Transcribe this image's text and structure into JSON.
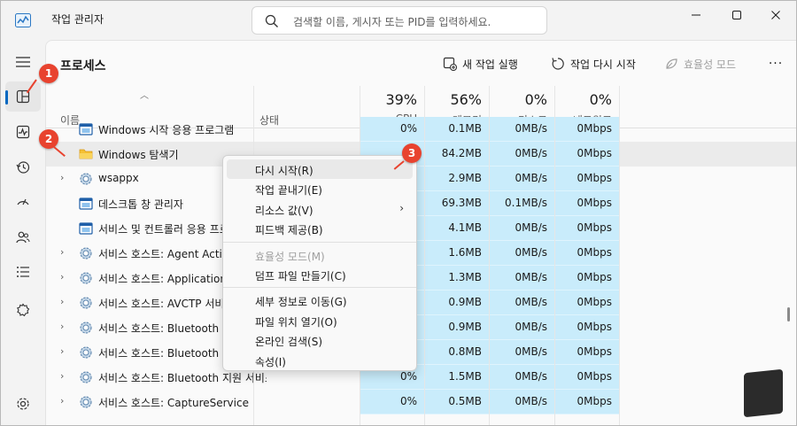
{
  "window": {
    "title": "작업 관리자",
    "search_placeholder": "검색할 이름, 게시자 또는 PID를 입력하세요."
  },
  "sidebar": {
    "items": [
      {
        "icon": "hamburger-menu-icon"
      },
      {
        "icon": "processes-icon",
        "active": true
      },
      {
        "icon": "performance-icon"
      },
      {
        "icon": "app-history-icon"
      },
      {
        "icon": "startup-apps-icon"
      },
      {
        "icon": "users-icon"
      },
      {
        "icon": "details-icon"
      },
      {
        "icon": "services-icon"
      },
      {
        "icon": "settings-icon"
      }
    ]
  },
  "toolbar": {
    "page_title": "프로세스",
    "run_task": "새 작업 실행",
    "restart_task": "작업 다시 시작",
    "efficiency_mode": "효율성 모드",
    "more": "···"
  },
  "columns": {
    "name": "이름",
    "status": "상태",
    "cpu_pct": "39%",
    "cpu": "CPU",
    "mem_pct": "56%",
    "mem": "메모리",
    "disk_pct": "0%",
    "disk": "디스크",
    "net_pct": "0%",
    "net": "네트워크"
  },
  "rows": [
    {
      "name": "Windows 시작 응용 프로그램",
      "expandable": false,
      "icon": "window-icon",
      "cpu": "0%",
      "mem": "0.1MB",
      "disk": "0MB/s",
      "net": "0Mbps"
    },
    {
      "name": "Windows 탐색기",
      "expandable": false,
      "icon": "folder-icon",
      "cpu": "",
      "mem": "84.2MB",
      "disk": "0MB/s",
      "net": "0Mbps",
      "selected": true
    },
    {
      "name": "wsappx",
      "expandable": true,
      "icon": "gear-icon",
      "cpu": "",
      "mem": "2.9MB",
      "disk": "0MB/s",
      "net": "0Mbps"
    },
    {
      "name": "데스크톱 창 관리자",
      "expandable": false,
      "icon": "window-icon",
      "cpu": "",
      "mem": "69.3MB",
      "disk": "0.1MB/s",
      "net": "0Mbps"
    },
    {
      "name": "서비스 및 컨트롤러 응용 프로그램",
      "expandable": false,
      "icon": "window-icon",
      "cpu": "",
      "mem": "4.1MB",
      "disk": "0MB/s",
      "net": "0Mbps"
    },
    {
      "name": "서비스 호스트: Agent Activation Runtime",
      "expandable": true,
      "icon": "gear-icon",
      "cpu": "",
      "mem": "1.6MB",
      "disk": "0MB/s",
      "net": "0Mbps"
    },
    {
      "name": "서비스 호스트: Application Information",
      "expandable": true,
      "icon": "gear-icon",
      "cpu": "",
      "mem": "1.3MB",
      "disk": "0MB/s",
      "net": "0Mbps"
    },
    {
      "name": "서비스 호스트: AVCTP 서비스",
      "expandable": true,
      "icon": "gear-icon",
      "cpu": "",
      "mem": "0.9MB",
      "disk": "0MB/s",
      "net": "0Mbps"
    },
    {
      "name": "서비스 호스트: Bluetooth Audio Gateway",
      "expandable": true,
      "icon": "gear-icon",
      "cpu": "",
      "mem": "0.9MB",
      "disk": "0MB/s",
      "net": "0Mbps"
    },
    {
      "name": "서비스 호스트: Bluetooth Support",
      "expandable": true,
      "icon": "gear-icon",
      "cpu": "",
      "mem": "0.8MB",
      "disk": "0MB/s",
      "net": "0Mbps"
    },
    {
      "name": "서비스 호스트: Bluetooth 지원 서비스",
      "expandable": true,
      "icon": "gear-icon",
      "cpu": "0%",
      "mem": "1.5MB",
      "disk": "0MB/s",
      "net": "0Mbps"
    },
    {
      "name": "서비스 호스트: CaptureService",
      "expandable": true,
      "icon": "gear-icon",
      "cpu": "0%",
      "mem": "0.5MB",
      "disk": "0MB/s",
      "net": "0Mbps"
    }
  ],
  "context_menu": {
    "items": [
      {
        "label": "다시 시작(R)",
        "hover": true
      },
      {
        "label": "작업 끝내기(E)"
      },
      {
        "label": "리소스 값(V)",
        "submenu": true
      },
      {
        "label": "피드백 제공(B)"
      },
      {
        "separator": true
      },
      {
        "label": "효율성 모드(M)",
        "disabled": true
      },
      {
        "label": "덤프 파일 만들기(C)"
      },
      {
        "separator": true
      },
      {
        "label": "세부 정보로 이동(G)"
      },
      {
        "label": "파일 위치 열기(O)"
      },
      {
        "label": "온라인 검색(S)"
      },
      {
        "label": "속성(I)"
      }
    ],
    "submenu_arrow": "›"
  },
  "badges": {
    "one": "1",
    "two": "2",
    "three": "3"
  },
  "colors": {
    "highlight": "#c9ecfb",
    "badge": "#e8432f",
    "accent": "#0067c0"
  }
}
